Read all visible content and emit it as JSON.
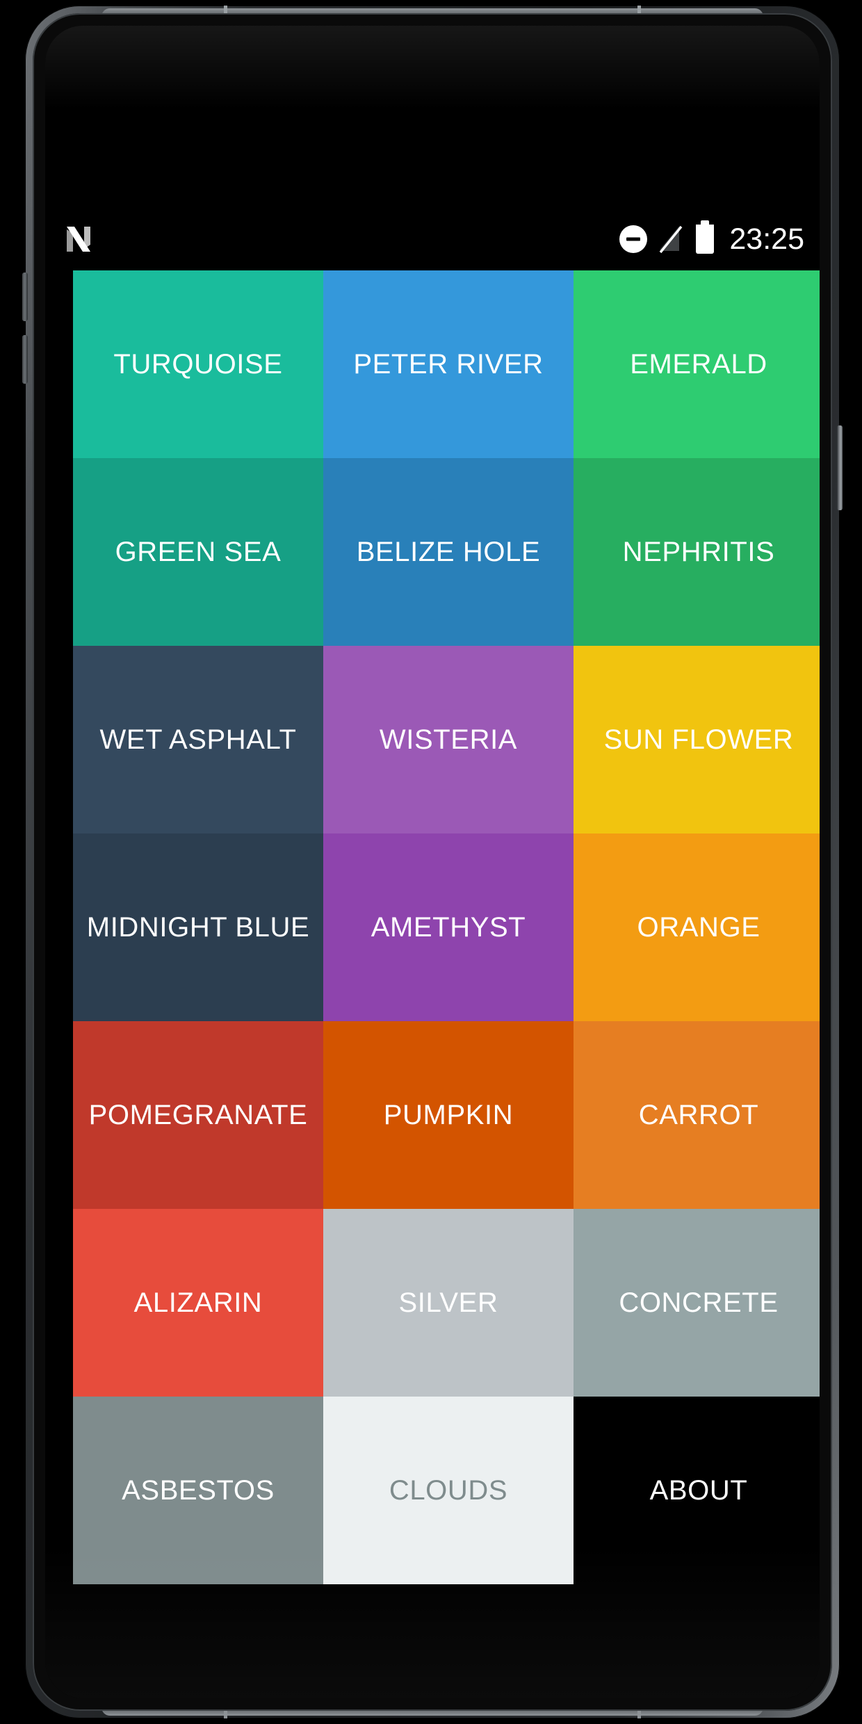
{
  "device": {
    "kind": "android-phone",
    "frame_color": "#2a2d30"
  },
  "status_bar": {
    "left_icon": "android-n-logo",
    "icons": [
      "do-not-disturb-icon",
      "signal-off-icon",
      "battery-icon"
    ],
    "clock": "23:25"
  },
  "grid": {
    "columns": 3,
    "rows": 7,
    "tiles": [
      {
        "label": "TURQUOISE",
        "color": "#1abc9c",
        "text_color": "#ffffff"
      },
      {
        "label": "PETER RIVER",
        "color": "#3498db",
        "text_color": "#ffffff"
      },
      {
        "label": "EMERALD",
        "color": "#2ecc71",
        "text_color": "#ffffff"
      },
      {
        "label": "GREEN SEA",
        "color": "#16a085",
        "text_color": "#ffffff"
      },
      {
        "label": "BELIZE HOLE",
        "color": "#2980b9",
        "text_color": "#ffffff"
      },
      {
        "label": "NEPHRITIS",
        "color": "#27ae60",
        "text_color": "#ffffff"
      },
      {
        "label": "WET ASPHALT",
        "color": "#34495e",
        "text_color": "#ffffff"
      },
      {
        "label": "WISTERIA",
        "color": "#9b59b6",
        "text_color": "#ffffff"
      },
      {
        "label": "SUN FLOWER",
        "color": "#f1c40f",
        "text_color": "#ffffff"
      },
      {
        "label": "MIDNIGHT BLUE",
        "color": "#2c3e50",
        "text_color": "#ffffff"
      },
      {
        "label": "AMETHYST",
        "color": "#8e44ad",
        "text_color": "#ffffff"
      },
      {
        "label": "ORANGE",
        "color": "#f39c12",
        "text_color": "#ffffff"
      },
      {
        "label": "POMEGRANATE",
        "color": "#c0392b",
        "text_color": "#ffffff"
      },
      {
        "label": "PUMPKIN",
        "color": "#d35400",
        "text_color": "#ffffff"
      },
      {
        "label": "CARROT",
        "color": "#e67e22",
        "text_color": "#ffffff"
      },
      {
        "label": "ALIZARIN",
        "color": "#e74c3c",
        "text_color": "#ffffff"
      },
      {
        "label": "SILVER",
        "color": "#bdc3c7",
        "text_color": "#ffffff"
      },
      {
        "label": "CONCRETE",
        "color": "#95a5a6",
        "text_color": "#ffffff"
      },
      {
        "label": "ASBESTOS",
        "color": "#7f8c8d",
        "text_color": "#ffffff"
      },
      {
        "label": "CLOUDS",
        "color": "#ecf0f1",
        "text_color": "#7f8c8d"
      },
      {
        "label": "ABOUT",
        "color": "#000000",
        "text_color": "#ffffff"
      }
    ]
  }
}
